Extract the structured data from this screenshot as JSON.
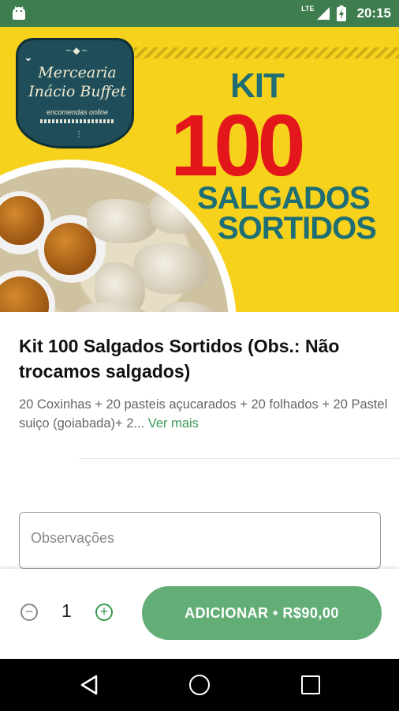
{
  "status_bar": {
    "network": "LTE",
    "time": "20:15",
    "icons": [
      "android-icon",
      "signal-icon",
      "battery-charging-icon"
    ]
  },
  "banner": {
    "logo_line1": "Mercearia",
    "logo_line2": "Inácio Buffet",
    "logo_tagline": "encomendas online",
    "headline_kit": "KIT",
    "headline_number": "100",
    "headline_word1": "SALGADOS",
    "headline_word2": "SORTIDOS",
    "colors": {
      "background": "#f7d21c",
      "number": "#e3161b",
      "text": "#1f6e74",
      "badge": "#1f4e5a"
    }
  },
  "product": {
    "title": "Kit 100 Salgados Sortidos  (Obs.: Não trocamos salgados)",
    "description": "20 Coxinhas + 20 pasteis açucarados + 20 folhados + 20 Pastel suiço (goiabada)+ 2...",
    "more_label": "Ver mais"
  },
  "notes": {
    "placeholder": "Observações",
    "value": ""
  },
  "cart": {
    "quantity": "1",
    "add_button_label": "ADICIONAR • R$90,00",
    "accent_color": "#3a9a52"
  }
}
